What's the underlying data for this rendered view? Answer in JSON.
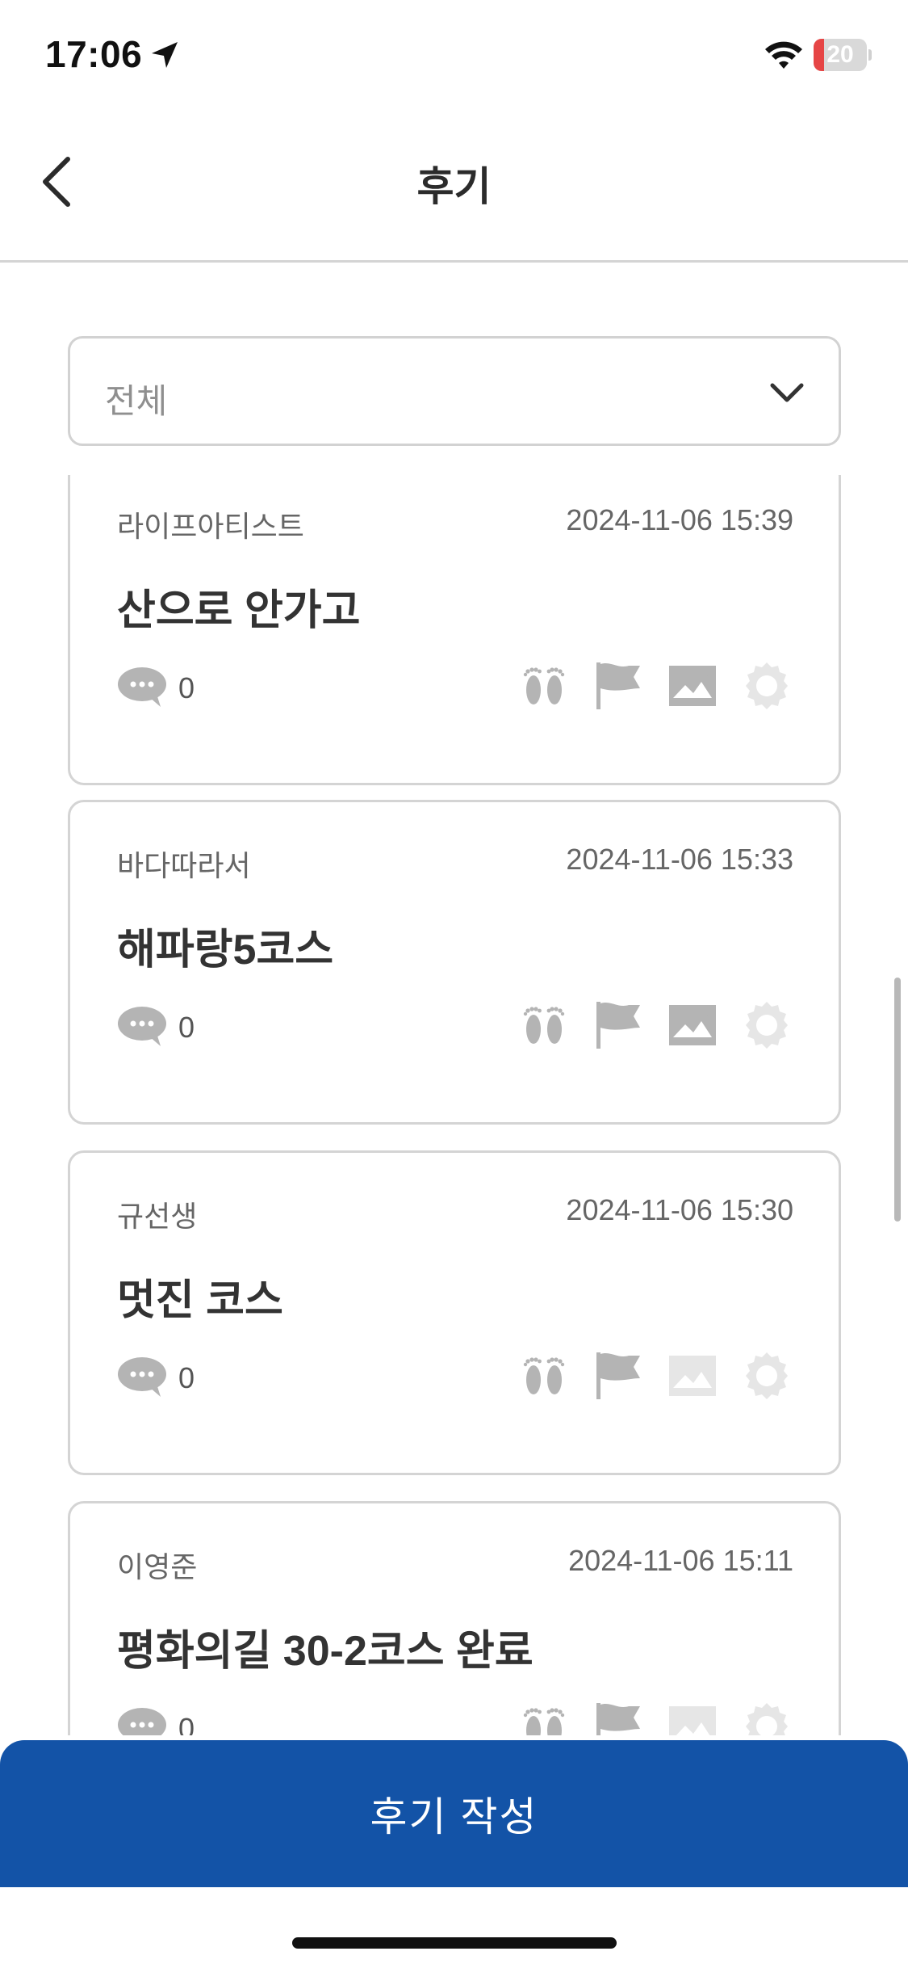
{
  "status_bar": {
    "time": "17:06",
    "battery": "20",
    "battery_level": 0.2,
    "battery_color": "#e64545"
  },
  "nav": {
    "title": "후기"
  },
  "filter": {
    "selected": "전체"
  },
  "reviews": [
    {
      "author": "라이프아티스트",
      "date": "2024-11-06 15:39",
      "title": "산으로 안가고",
      "comments": "0",
      "badges": {
        "footprints": true,
        "flag": true,
        "photo": true,
        "award": false
      }
    },
    {
      "author": "바다따라서",
      "date": "2024-11-06 15:33",
      "title": "해파랑5코스",
      "comments": "0",
      "badges": {
        "footprints": true,
        "flag": true,
        "photo": true,
        "award": false
      }
    },
    {
      "author": "규선생",
      "date": "2024-11-06 15:30",
      "title": "멋진 코스",
      "comments": "0",
      "badges": {
        "footprints": true,
        "flag": true,
        "photo": false,
        "award": false
      }
    },
    {
      "author": "이영준",
      "date": "2024-11-06 15:11",
      "title": "평화의길 30-2코스 완료",
      "comments": "0",
      "badges": {
        "footprints": true,
        "flag": true,
        "photo": false,
        "award": false
      }
    }
  ],
  "write_button": {
    "label": "후기 작성"
  },
  "colors": {
    "accent": "#1353a7",
    "icon_active": "#b4b4b4",
    "icon_inactive": "#e6e6e6"
  }
}
